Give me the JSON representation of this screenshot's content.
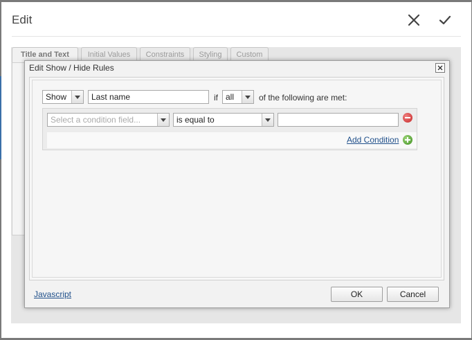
{
  "window": {
    "title": "Edit"
  },
  "tabs": [
    {
      "label": "Title and Text",
      "active": true
    },
    {
      "label": "Initial Values",
      "active": false
    },
    {
      "label": "Constraints",
      "active": false
    },
    {
      "label": "Styling",
      "active": false
    },
    {
      "label": "Custom",
      "active": false
    }
  ],
  "dialog": {
    "title": "Edit Show / Hide Rules",
    "action": {
      "selected": "Show"
    },
    "target_field": {
      "value": "Last name"
    },
    "if_label": "if",
    "quantifier": {
      "selected": "all"
    },
    "following_label": "of the following are met:",
    "condition": {
      "field_placeholder": "Select a condition field...",
      "operator": "is equal to",
      "value": ""
    },
    "add_condition_label": "Add Condition",
    "javascript_label": "Javascript",
    "ok_label": "OK",
    "cancel_label": "Cancel"
  },
  "colors": {
    "link": "#1f4f8a",
    "remove_icon": "#c62828",
    "add_icon": "#3e8e1f"
  }
}
